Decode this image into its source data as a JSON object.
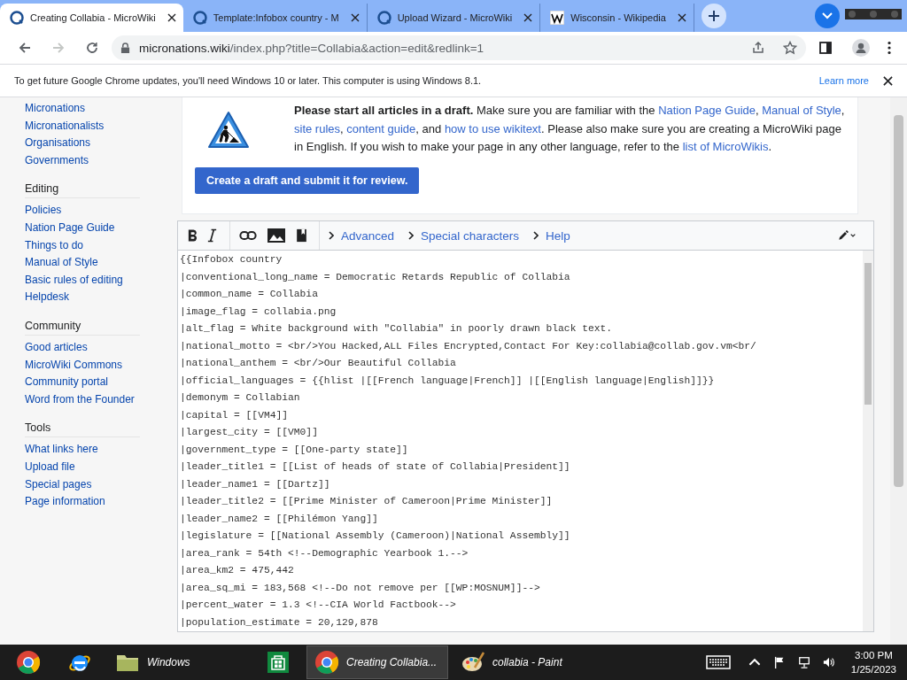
{
  "tabs": [
    {
      "title": "Creating Collabia - MicroWiki",
      "kind": "wiki",
      "selected": true
    },
    {
      "title": "Template:Infobox country - M",
      "kind": "wiki",
      "selected": false
    },
    {
      "title": "Upload Wizard - MicroWiki",
      "kind": "wiki",
      "selected": false
    },
    {
      "title": "Wisconsin - Wikipedia",
      "kind": "wikipedia",
      "selected": false
    }
  ],
  "address_bar": {
    "host": "micronations.wiki",
    "path": "/index.php?title=Collabia&action=edit&redlink=1",
    "forward_disabled": true
  },
  "info_bar": {
    "message": "To get future Google Chrome updates, you'll need Windows 10 or later. This computer is using Windows 8.1.",
    "link": "Learn more"
  },
  "sidebar": {
    "sections": [
      {
        "items": [
          "Micronations",
          "Micronationalists",
          "Organisations",
          "Governments"
        ]
      },
      {
        "heading": "Editing",
        "items": [
          "Policies",
          "Nation Page Guide",
          "Things to do",
          "Manual of Style",
          "Basic rules of editing",
          "Helpdesk"
        ]
      },
      {
        "heading": "Community",
        "items": [
          "Good articles",
          "MicroWiki Commons",
          "Community portal",
          "Word from the Founder"
        ]
      },
      {
        "heading": "Tools",
        "items": [
          "What links here",
          "Upload file",
          "Special pages",
          "Page information"
        ]
      }
    ]
  },
  "notice": {
    "segments": [
      {
        "kind": "bold",
        "text": "Please start all articles in a draft."
      },
      {
        "kind": "text",
        "text": " Make sure you are familiar with the "
      },
      {
        "kind": "link",
        "text": "Nation Page Guide"
      },
      {
        "kind": "text",
        "text": ", "
      },
      {
        "kind": "link",
        "text": "Manual of Style"
      },
      {
        "kind": "text",
        "text": ", "
      },
      {
        "kind": "link",
        "text": "site rules"
      },
      {
        "kind": "text",
        "text": ", "
      },
      {
        "kind": "link",
        "text": "content guide"
      },
      {
        "kind": "text",
        "text": ", and "
      },
      {
        "kind": "link",
        "text": "how to use wikitext"
      },
      {
        "kind": "text",
        "text": ". Please also make sure you are creating a MicroWiki page in English. If you wish to make your page in any other language, refer to the "
      },
      {
        "kind": "link",
        "text": "list of MicroWikis"
      },
      {
        "kind": "text",
        "text": "."
      }
    ],
    "button": "Create a draft and submit it for review."
  },
  "editor": {
    "toolbar_links": [
      "Advanced",
      "Special characters",
      "Help"
    ],
    "lines": [
      "{{Infobox country",
      "|conventional_long_name = Democratic Retards Republic of Collabia",
      "|common_name = Collabia",
      "|image_flag = collabia.png",
      "|alt_flag = White background with \"Collabia\" in poorly drawn black text.",
      "|national_motto = <br/>You Hacked,ALL Files Encrypted,Contact For Key:collabia@collab.gov.vm<br/",
      "|national_anthem = <br/>Our Beautiful Collabia",
      "|official_languages = {{hlist |[[French language|French]] |[[English language|English]]}}",
      "|demonym = Collabian",
      "|capital = [[VM4]]",
      "|largest_city = [[VM0]]",
      "|government_type = [[One-party state]]",
      "|leader_title1 = [[List of heads of state of Collabia|President]]",
      "|leader_name1 = [[Dartz]]",
      "|leader_title2 = [[Prime Minister of Cameroon|Prime Minister]]",
      "|leader_name2 = [[Philémon Yang]]",
      "|legislature = [[National Assembly (Cameroon)|National Assembly]]",
      "|area_rank = 54th <!--Demographic Yearbook 1.-->",
      "|area_km2 = 475,442",
      "|area_sq_mi = 183,568 <!--Do not remove per [[WP:MOSNUM]]-->",
      "|percent_water = 1.3 <!--CIA World Factbook-->",
      "|population_estimate = 20,129,878"
    ]
  },
  "taskbar": {
    "items": [
      {
        "kind": "chrome-pin",
        "selected": false
      },
      {
        "kind": "ie",
        "selected": false
      },
      {
        "kind": "folder",
        "label": "Windows",
        "selected": false
      },
      {
        "kind": "store",
        "selected": false
      },
      {
        "kind": "chrome",
        "label": "Creating Collabia...",
        "selected": true
      },
      {
        "kind": "paint",
        "label": "collabia - Paint",
        "selected": false
      }
    ],
    "time": "3:00 PM",
    "date": "1/25/2023"
  }
}
